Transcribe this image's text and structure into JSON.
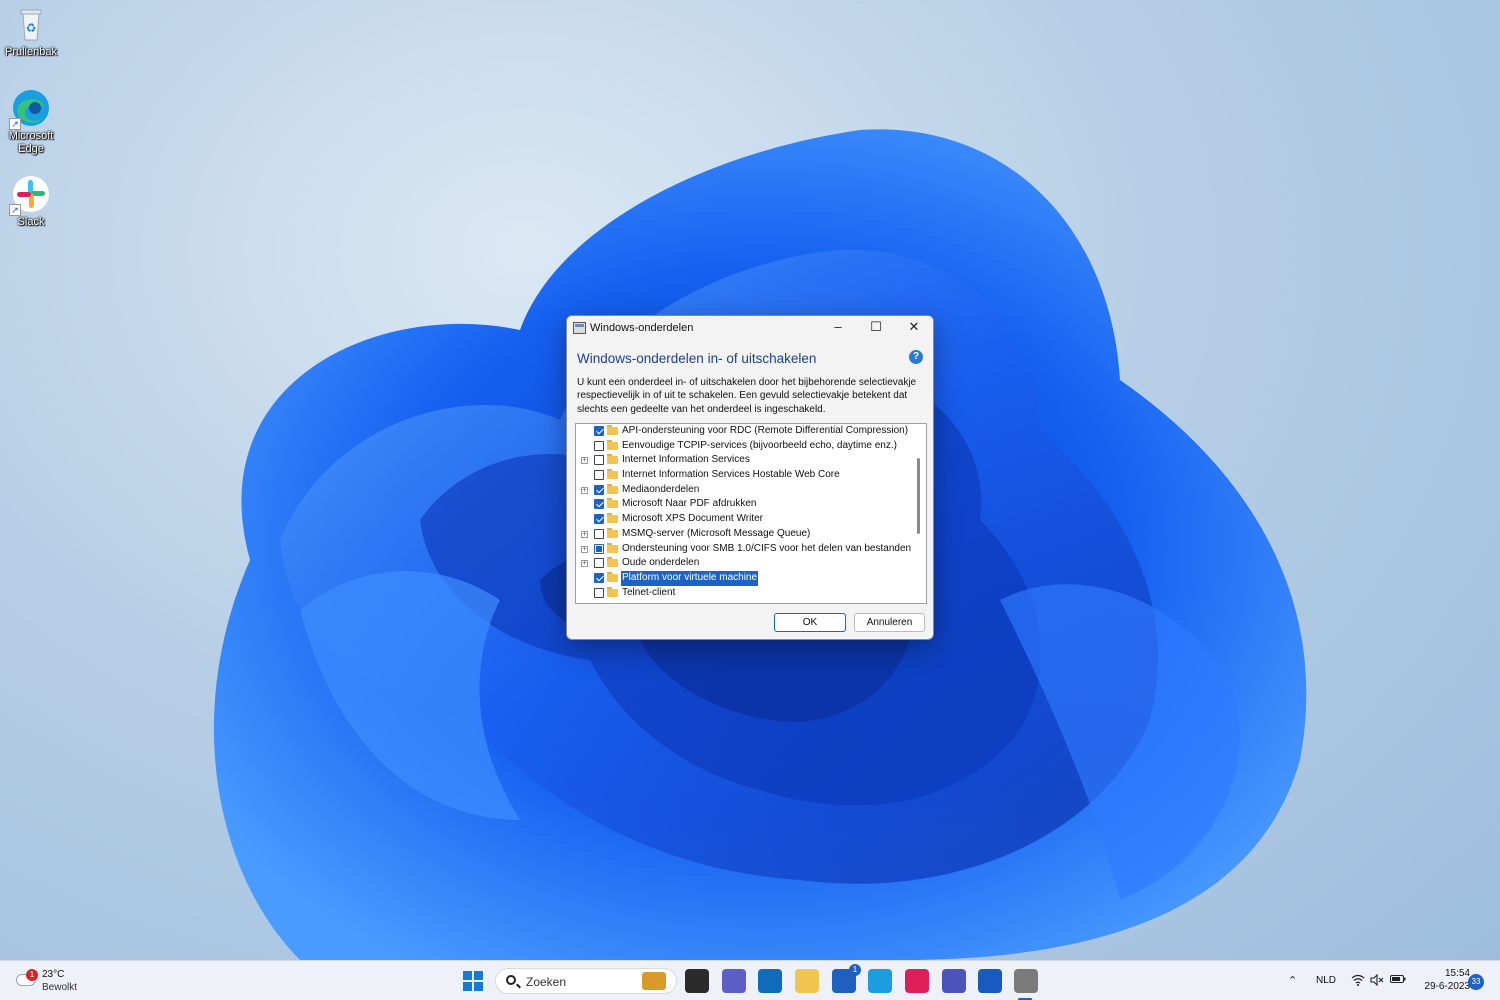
{
  "desktop": {
    "icons": [
      {
        "label": "Prullenbak",
        "icon": "recycle-bin-icon"
      },
      {
        "label": "Microsoft Edge",
        "icon": "edge-icon"
      },
      {
        "label": "Slack",
        "icon": "slack-icon"
      }
    ]
  },
  "dialog": {
    "title": "Windows-onderdelen",
    "heading": "Windows-onderdelen in- of uitschakelen",
    "help_glyph": "?",
    "description": "U kunt een onderdeel in- of uitschakelen door het bijbehorende selectievakje respectievelijk in of uit te schakelen. Een gevuld selectievakje betekent dat slechts een gedeelte van het onderdeel is ingeschakeld.",
    "features": [
      {
        "label": "API-ondersteuning voor RDC (Remote Differential Compression)",
        "state": "checked",
        "expandable": false,
        "selected": false
      },
      {
        "label": "Eenvoudige TCPIP-services (bijvoorbeeld echo, daytime enz.)",
        "state": "unchecked",
        "expandable": false,
        "selected": false
      },
      {
        "label": "Internet Information Services",
        "state": "unchecked",
        "expandable": true,
        "selected": false
      },
      {
        "label": "Internet Information Services Hostable Web Core",
        "state": "unchecked",
        "expandable": false,
        "selected": false
      },
      {
        "label": "Mediaonderdelen",
        "state": "checked",
        "expandable": true,
        "selected": false
      },
      {
        "label": "Microsoft Naar PDF afdrukken",
        "state": "checked",
        "expandable": false,
        "selected": false
      },
      {
        "label": "Microsoft XPS Document Writer",
        "state": "checked",
        "expandable": false,
        "selected": false
      },
      {
        "label": "MSMQ-server (Microsoft Message Queue)",
        "state": "unchecked",
        "expandable": true,
        "selected": false
      },
      {
        "label": "Ondersteuning voor SMB 1.0/CIFS voor het delen van bestanden",
        "state": "partial",
        "expandable": true,
        "selected": false
      },
      {
        "label": "Oude onderdelen",
        "state": "unchecked",
        "expandable": true,
        "selected": false
      },
      {
        "label": "Platform voor virtuele machine",
        "state": "checked",
        "expandable": false,
        "selected": true
      },
      {
        "label": "Telnet-client",
        "state": "unchecked",
        "expandable": false,
        "selected": false
      }
    ],
    "ok_label": "OK",
    "cancel_label": "Annuleren"
  },
  "taskbar": {
    "weather": {
      "temperature": "23°C",
      "condition": "Bewolkt",
      "badge": "1"
    },
    "search_placeholder": "Zoeken",
    "apps": [
      {
        "name": "taskview-icon",
        "color": "#2b2b2b"
      },
      {
        "name": "teams-chat-icon",
        "color": "#5b5fc7"
      },
      {
        "name": "outlook-icon",
        "color": "#0f6cbd"
      },
      {
        "name": "file-explorer-icon",
        "color": "#f2c550"
      },
      {
        "name": "store-icon",
        "color": "#1f5fbf",
        "badge": "1"
      },
      {
        "name": "edge-icon",
        "color": "#1b9de2"
      },
      {
        "name": "slack-icon",
        "color": "#e01e5a"
      },
      {
        "name": "teams-icon",
        "color": "#4b53bc"
      },
      {
        "name": "word-icon",
        "color": "#185abd"
      },
      {
        "name": "windows-features-icon",
        "color": "#7a7a7a"
      }
    ],
    "tray": {
      "language": "NLD",
      "time": "15:54",
      "date": "29-6-2023",
      "notifications": "33"
    }
  }
}
